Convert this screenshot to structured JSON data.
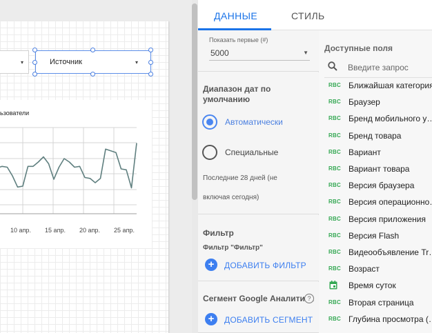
{
  "canvas": {
    "source_dropdown_label": "Источник",
    "chart": {
      "title_fragment": "ьзователи"
    }
  },
  "chart_data": {
    "type": "line",
    "title": "ьзователи",
    "x_tick_labels": [
      "10 апр.",
      "15 апр.",
      "20 апр.",
      "25 апр."
    ],
    "x": [
      1,
      2,
      3,
      4,
      5,
      6,
      7,
      8,
      9,
      10,
      11,
      12,
      13,
      14,
      15,
      16,
      17,
      18,
      19,
      20,
      21,
      22,
      23,
      24,
      25,
      26,
      27,
      28,
      29
    ],
    "values": [
      55,
      53,
      55,
      54,
      44,
      31,
      32,
      55,
      55,
      60,
      66,
      58,
      40,
      54,
      64,
      60,
      54,
      55,
      42,
      41,
      36,
      41,
      75,
      73,
      71,
      52,
      51,
      30,
      82
    ],
    "ylim": [
      0,
      100
    ],
    "grid": true,
    "color": "#5f7f7f"
  },
  "panel": {
    "tabs": [
      {
        "label": "ДАННЫЕ",
        "active": true
      },
      {
        "label": "СТИЛЬ",
        "active": false
      }
    ],
    "rows": {
      "label": "Показать первые (#)",
      "value": "5000"
    },
    "date_range": {
      "title_line1": "Диапазон дат по",
      "title_line2": "умолчанию",
      "option_auto": "Автоматически",
      "option_custom": "Специальные",
      "note_line1": "Последние 28 дней (не",
      "note_line2": "включая сегодня)"
    },
    "filter": {
      "title": "Фильтр",
      "subtitle": "Фильтр \"Фильтр\"",
      "add_label": "ДОБАВИТЬ ФИЛЬТР"
    },
    "segment": {
      "title": "Сегмент Google Аналитики",
      "help": "?",
      "add_label": "ДОБАВИТЬ СЕГМЕНТ"
    },
    "fields": {
      "title": "Доступные поля",
      "search_placeholder": "Введите запрос",
      "items": [
        {
          "type": "RBC",
          "name": "Ближайшая категория (…"
        },
        {
          "type": "RBC",
          "name": "Браузер"
        },
        {
          "type": "RBC",
          "name": "Бренд мобильного у…"
        },
        {
          "type": "RBC",
          "name": "Бренд товара"
        },
        {
          "type": "RBC",
          "name": "Вариант"
        },
        {
          "type": "RBC",
          "name": "Вариант товара"
        },
        {
          "type": "RBC",
          "name": "Версия браузера"
        },
        {
          "type": "RBC",
          "name": "Версия операционно…"
        },
        {
          "type": "RBC",
          "name": "Версия приложения"
        },
        {
          "type": "RBC",
          "name": "Версия Flash"
        },
        {
          "type": "RBC",
          "name": "Видеообъявление Tr…"
        },
        {
          "type": "RBC",
          "name": "Возраст"
        },
        {
          "type": "date",
          "name": "Время суток"
        },
        {
          "type": "RBC",
          "name": "Вторая страница"
        },
        {
          "type": "RBC",
          "name": "Глубина просмотра (…"
        }
      ]
    }
  }
}
